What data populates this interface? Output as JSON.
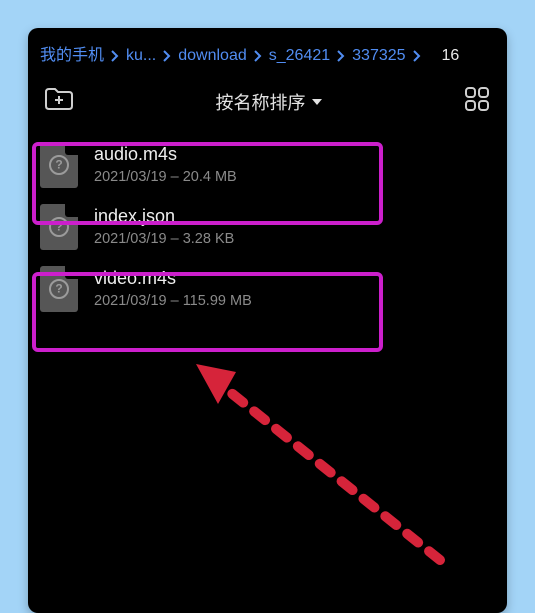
{
  "breadcrumb": {
    "items": [
      {
        "label": "我的手机"
      },
      {
        "label": "ku..."
      },
      {
        "label": "download"
      },
      {
        "label": "s_26421"
      },
      {
        "label": "337325"
      }
    ],
    "count": "16"
  },
  "sort": {
    "label": "按名称排序"
  },
  "files": [
    {
      "name": "audio.m4s",
      "meta": "2021/03/19 – 20.4 MB",
      "highlighted": true
    },
    {
      "name": "index.json",
      "meta": "2021/03/19 – 3.28 KB",
      "highlighted": false
    },
    {
      "name": "video.m4s",
      "meta": "2021/03/19 – 115.99 MB",
      "highlighted": true
    }
  ],
  "icons": {
    "new_folder": "new-folder-icon",
    "grid": "grid-view-icon",
    "file": "unknown-file-icon",
    "chevron": "chevron-right-icon",
    "caret_down": "caret-down-icon"
  },
  "annotation": {
    "arrow_color": "#d6243a"
  }
}
